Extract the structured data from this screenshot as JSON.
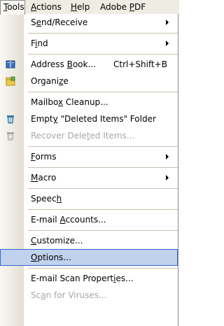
{
  "menubar": {
    "items": [
      {
        "label": "Tools",
        "accel": "T",
        "active": true
      },
      {
        "label": "Actions",
        "accel": "A"
      },
      {
        "label": "Help",
        "accel": "H"
      },
      {
        "label": "Adobe PDF",
        "accel": "P"
      }
    ]
  },
  "menu": {
    "items": [
      {
        "label": "Send/Receive",
        "submenu": true
      },
      {
        "label": "Find",
        "submenu": true
      },
      {
        "label": "Address Book...",
        "shortcut": "Ctrl+Shift+B",
        "icon": "address-book-icon"
      },
      {
        "label": "Organize",
        "icon": "organize-icon"
      },
      {
        "label": "Mailbox Cleanup..."
      },
      {
        "label": "Empty \"Deleted Items\" Folder",
        "icon": "recycle-bin-icon"
      },
      {
        "label": "Recover Deleted Items...",
        "disabled": true,
        "icon": "recover-items-icon"
      },
      {
        "label": "Forms",
        "submenu": true
      },
      {
        "label": "Macro",
        "submenu": true
      },
      {
        "label": "Speech"
      },
      {
        "label": "E-mail Accounts..."
      },
      {
        "label": "Customize..."
      },
      {
        "label": "Options...",
        "selected": true
      },
      {
        "label": "E-mail Scan Properties..."
      },
      {
        "label": "Scan for Viruses...",
        "disabled": true
      }
    ]
  },
  "colors": {
    "menubar_bg": "#eeece3",
    "gutter": "#e2dfd3",
    "highlight_bg": "#c1d2ee",
    "highlight_border": "#316ac5",
    "disabled_text": "#a7a6aa"
  }
}
